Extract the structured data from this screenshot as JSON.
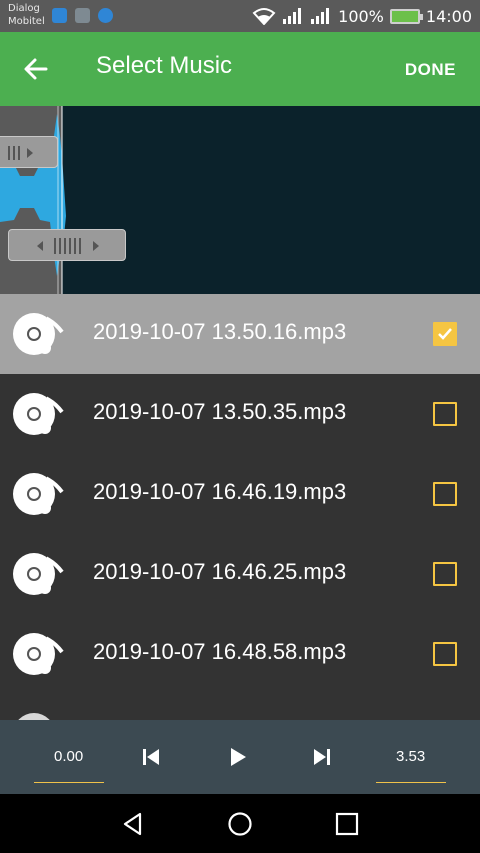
{
  "status_bar": {
    "carrier_line1": "Dialog",
    "carrier_line2": "Mobitel",
    "battery_percent": "100%",
    "time": "14:00"
  },
  "app_bar": {
    "title": "Select Music",
    "done_label": "DONE"
  },
  "files": [
    {
      "name": "2019-10-07 13.50.16.mp3",
      "checked": true
    },
    {
      "name": "2019-10-07 13.50.35.mp3",
      "checked": false
    },
    {
      "name": "2019-10-07 16.46.19.mp3",
      "checked": false
    },
    {
      "name": "2019-10-07 16.46.25.mp3",
      "checked": false
    },
    {
      "name": "2019-10-07 16.48.58.mp3",
      "checked": false
    }
  ],
  "player": {
    "start_time": "0.00",
    "end_time": "3.53"
  },
  "colors": {
    "accent": "#4caf50",
    "checkbox": "#f5c542",
    "waveform": "#2ea8e0"
  }
}
